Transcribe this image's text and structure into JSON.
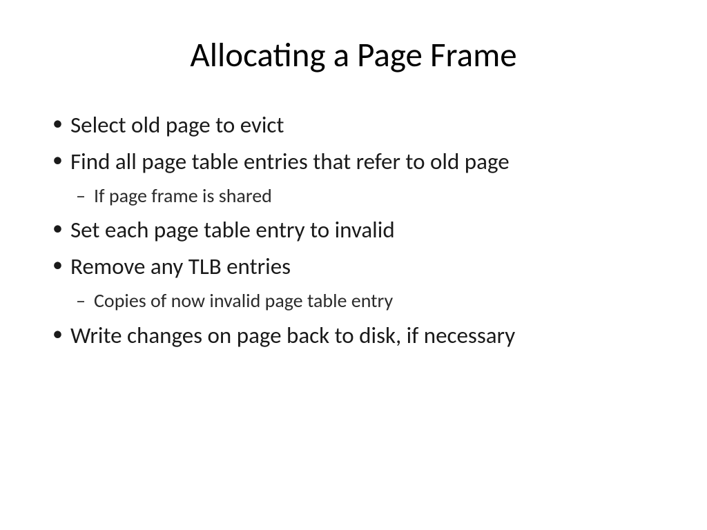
{
  "slide": {
    "title": "Allocating a Page Frame",
    "bullets": [
      {
        "text": "Select old page to evict",
        "level": 1
      },
      {
        "text": "Find all page table entries that refer to old page",
        "level": 1
      },
      {
        "text": "If page frame is shared",
        "level": 2
      },
      {
        "text": "Set each page table entry to invalid",
        "level": 1
      },
      {
        "text": "Remove any TLB entries",
        "level": 1
      },
      {
        "text": "Copies of now invalid page table entry",
        "level": 2
      },
      {
        "text": "Write changes on page back to disk, if necessary",
        "level": 1
      }
    ]
  }
}
